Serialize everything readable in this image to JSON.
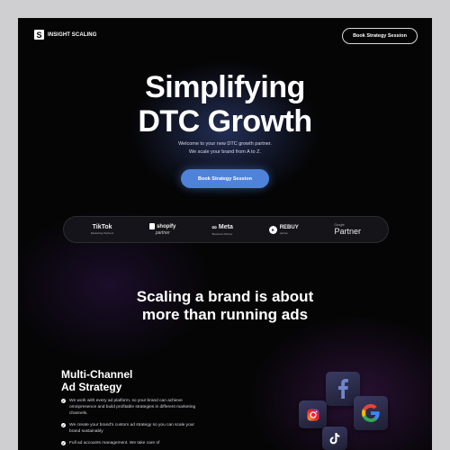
{
  "nav": {
    "logo_mark": "S",
    "logo_text": "INSIGHT SCALING",
    "cta_label": "Book Strategy Session"
  },
  "hero": {
    "title_line1": "Simplifying",
    "title_line2": "DTC Growth",
    "subtitle_line1": "Welcome to your new DTC growth partner.",
    "subtitle_line2": "We scale your brand from A to Z.",
    "cta_label": "Book Strategy Session"
  },
  "partners": [
    {
      "name": "TikTok",
      "sub": "Marketing Partners"
    },
    {
      "name": "shopify",
      "sub": "partner"
    },
    {
      "name": "Meta",
      "sub": "Business Partner"
    },
    {
      "name": "REBUY",
      "sub": "partner"
    },
    {
      "name": "Partner",
      "sub": "Google"
    }
  ],
  "section": {
    "title_line1": "Scaling a brand is about",
    "title_line2": "more than running ads"
  },
  "feature": {
    "title_line1": "Multi-Channel",
    "title_line2": "Ad Strategy",
    "items": [
      "We work with every ad platform, so your brand can achieve omnipresence and build profitable strategies in different marketing channels.",
      "We create your brand’s custom ad strategy so you can scale your brand sustainably",
      "Full ad accounts management. We take care of"
    ]
  },
  "icons": [
    "facebook-icon",
    "google-icon",
    "instagram-icon",
    "tiktok-icon"
  ],
  "colors": {
    "background": "#050506",
    "accent": "#4f82d9"
  }
}
